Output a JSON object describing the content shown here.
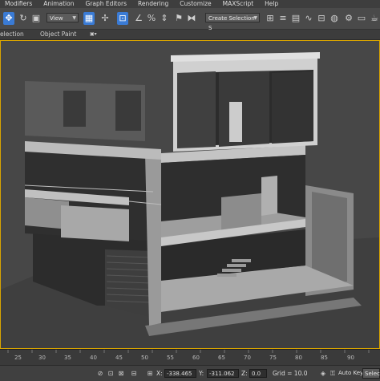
{
  "menu": [
    "Modifiers",
    "Animation",
    "Graph Editors",
    "Rendering",
    "Customize",
    "MAXScript",
    "Help"
  ],
  "toolbar": {
    "view_dropdown": "View",
    "selection_set_dropdown": "Create Selection S",
    "icons": [
      "select-icon",
      "rotate-icon",
      "scale-icon",
      "select-filter-icon",
      "pivot-icon",
      "select-manipulate-icon",
      "snap-3d-icon",
      "angle-snap-icon",
      "percent-snap-icon",
      "spinner-snap-icon",
      "edit-named-sets-icon",
      "mirror-icon",
      "align-icon",
      "layer-manager-icon",
      "graphite-icon",
      "curve-editor-icon",
      "schematic-view-icon",
      "material-editor-icon",
      "render-setup-icon",
      "rendered-frame-icon",
      "render-icon"
    ]
  },
  "ribbon": {
    "left_label": "election",
    "object_paint_label": "Object Paint"
  },
  "timeline": {
    "ticks": [
      "25",
      "30",
      "35",
      "40",
      "45",
      "50",
      "55",
      "60",
      "65",
      "70",
      "75",
      "80",
      "85",
      "90"
    ]
  },
  "statusbar": {
    "x_label": "X:",
    "x_value": "-338.465",
    "y_label": "Y:",
    "y_value": "-311.062",
    "z_label": "Z:",
    "z_value": "0.0",
    "grid_label": "Grid = 10.0",
    "auto_key_label": "Auto Key",
    "selected_dropdown": "Selecte"
  },
  "colors": {
    "viewport_border": "#d8a400",
    "active_tool": "#3a7bd5",
    "viewport_bg": "#474747"
  }
}
